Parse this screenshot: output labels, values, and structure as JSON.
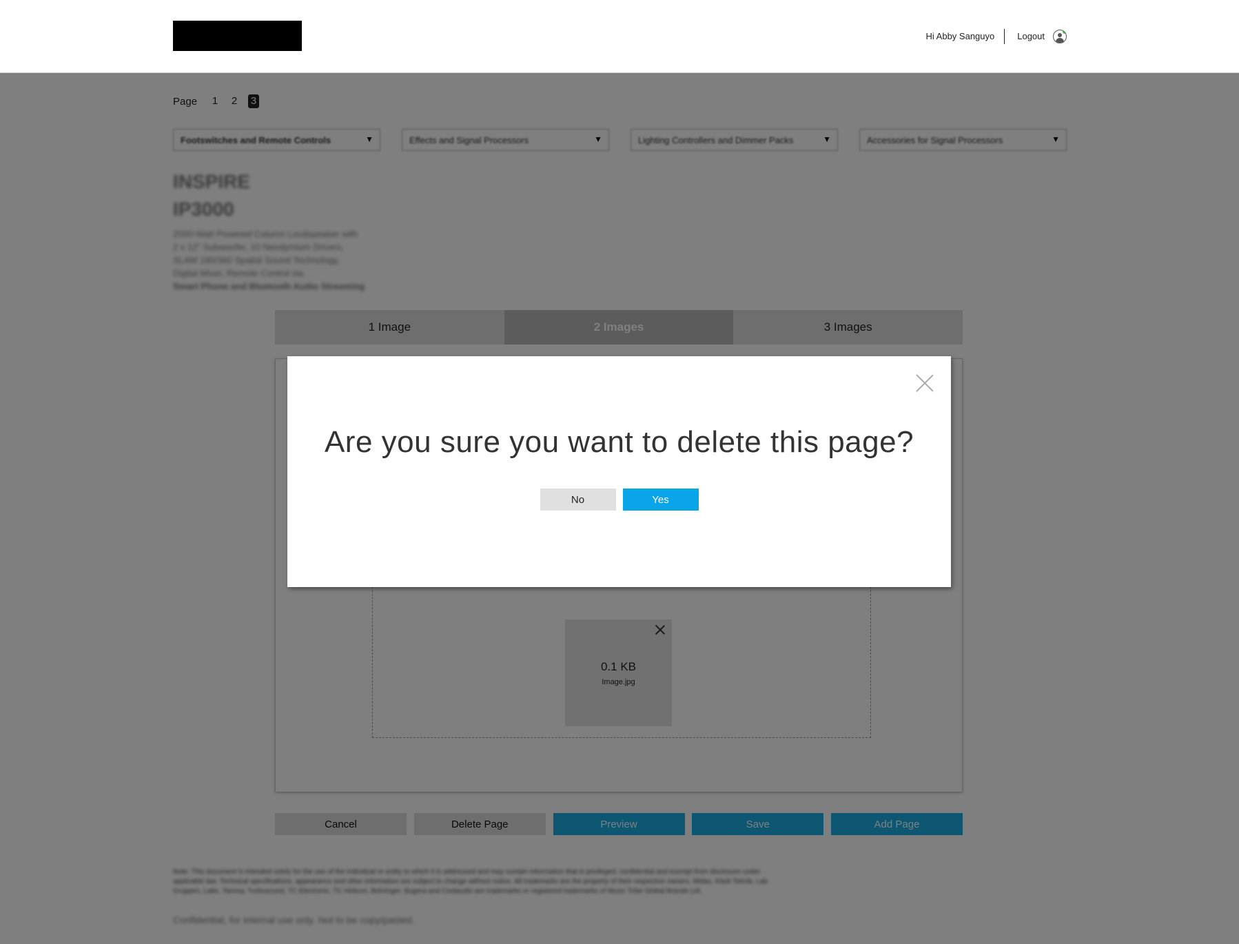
{
  "header": {
    "greeting": "Hi Abby Sanguyo",
    "logout_label": "Logout"
  },
  "pager": {
    "label": "Page",
    "pages": [
      "1",
      "2",
      "3"
    ],
    "active_page": "3"
  },
  "dropdowns": [
    {
      "value": "Footswitches and Remote Controls",
      "caret": "▼"
    },
    {
      "value": "Effects and Signal Processors",
      "caret": "▼"
    },
    {
      "value": "Lighting Controllers and Dimmer Packs",
      "caret": "▼"
    },
    {
      "value": "Accessories for Signal Processors",
      "caret": "▼"
    }
  ],
  "product": {
    "brand": "INSPIRE",
    "model": "IP3000",
    "desc_lines": [
      "2000-Watt Powered Column Loudspeaker with",
      "2 x 12\" Subwoofer, 10 Neodymium Drivers,",
      "SLAM 180/360 Spatial Sound Technology,",
      "Digital Mixer, Remote Control via",
      "Smart Phone and Bluetooth Audio Streaming"
    ]
  },
  "tabs": [
    {
      "label": "1 Image"
    },
    {
      "label": "2 Images"
    },
    {
      "label": "3 Images"
    }
  ],
  "thumbnail": {
    "size": "0.1 KB",
    "filename": "Image.jpg"
  },
  "actions": {
    "cancel": "Cancel",
    "delete_page": "Delete Page",
    "preview": "Preview",
    "save": "Save",
    "add_page": "Add Page"
  },
  "footer": {
    "legal": "Note: This document is intended solely for the use of the individual or entity to which it is addressed and may contain information that is privileged, confidential and exempt from disclosure under applicable law. Technical specifications, appearance and other information are subject to change without notice. All trademarks are the property of their respective owners. Midas, Klark Teknik, Lab Gruppen, Lake, Tannoy, Turbosound, TC Electronic, TC Helicon, Behringer, Bugera and Coolaudio are trademarks or registered trademarks of Music Tribe Global Brands Ltd.",
    "confidential": "Confidential, for internal use only. Not to be copy/pasted."
  },
  "modal": {
    "title": "Are you sure you want to delete this page?",
    "no_label": "No",
    "yes_label": "Yes"
  },
  "colors": {
    "primary_button": "#1aaee6",
    "modal_yes": "#0aa4e8",
    "overlay": "rgba(0,0,0,0.5)"
  }
}
